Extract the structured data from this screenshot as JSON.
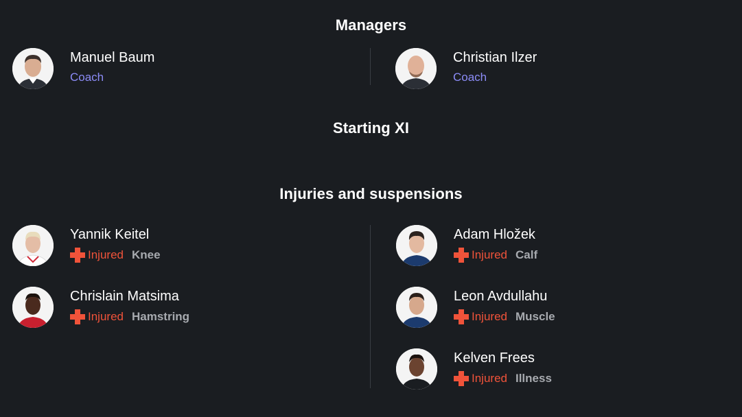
{
  "managers": {
    "title": "Managers",
    "people": [
      {
        "name": "Manuel Baum",
        "role": "Coach"
      },
      {
        "name": "Christian Ilzer",
        "role": "Coach"
      }
    ]
  },
  "starting_xi": {
    "title": "Starting XI"
  },
  "injuries": {
    "title": "Injuries and suspensions",
    "players": [
      {
        "name": "Yannik Keitel",
        "status": "Injured",
        "reason": "Knee"
      },
      {
        "name": "Chrislain Matsima",
        "status": "Injured",
        "reason": "Hamstring"
      },
      {
        "name": "Adam Hložek",
        "status": "Injured",
        "reason": "Calf"
      },
      {
        "name": "Leon Avdullahu",
        "status": "Injured",
        "reason": "Muscle"
      },
      {
        "name": "Kelven Frees",
        "status": "Injured",
        "reason": "Illness"
      }
    ]
  },
  "colors": {
    "background": "#1a1d21",
    "role_accent": "#8c8cf7",
    "injured": "#f0533a",
    "reason_text": "#a7aaaf"
  }
}
